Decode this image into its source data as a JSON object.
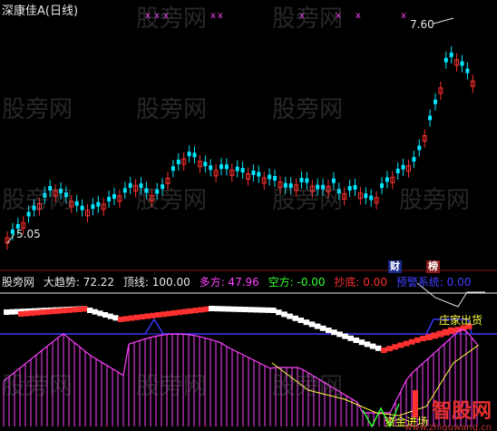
{
  "title": "深康佳A(日线)",
  "price_high_label": "7.60",
  "price_low_label": "5.05",
  "tags": {
    "cai": "财",
    "bang": "榜"
  },
  "indicator": {
    "prefix": "股旁网",
    "trend": "大趋势: 72.22",
    "top": "顶线: 100.00",
    "long": "多方: 47.96",
    "short": "空方: -0.00",
    "bottom": "抄底: 0.00",
    "warn": "预警系统: 0.00"
  },
  "annotations": {
    "dealer_out": "庄家出货",
    "fund_in": "资金进场"
  },
  "watermark": "股旁网",
  "logo": {
    "main": "智股网",
    "sub": "www.zhiguwang.cn"
  },
  "colors": {
    "up": "#ff3030",
    "down": "#00e5ff",
    "magenta": "#ff40ff",
    "blue": "#3a3aff",
    "yellow": "#ffff40",
    "green": "#30ff30"
  }
}
